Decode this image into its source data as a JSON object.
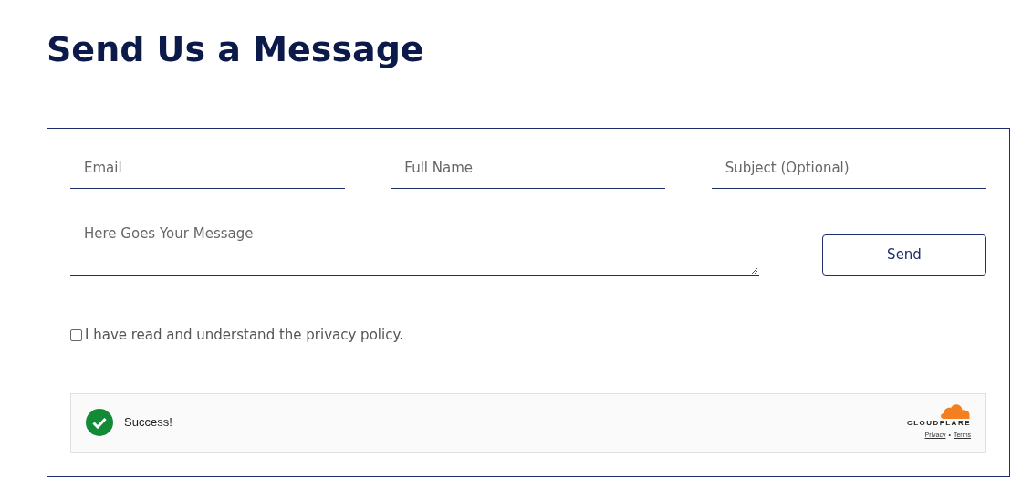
{
  "heading": "Send Us a Message",
  "fields": [
    {
      "placeholder": "Email"
    },
    {
      "placeholder": "Full Name"
    },
    {
      "placeholder": "Subject (Optional)"
    }
  ],
  "message": {
    "placeholder": "Here Goes Your Message"
  },
  "send_button": "Send",
  "consent": {
    "label": "I have read and understand the privacy policy.",
    "checked": false
  },
  "captcha": {
    "status": "Success!",
    "brand": "CLOUDFLARE",
    "links": [
      "Privacy",
      "Terms"
    ],
    "separator": "•"
  }
}
